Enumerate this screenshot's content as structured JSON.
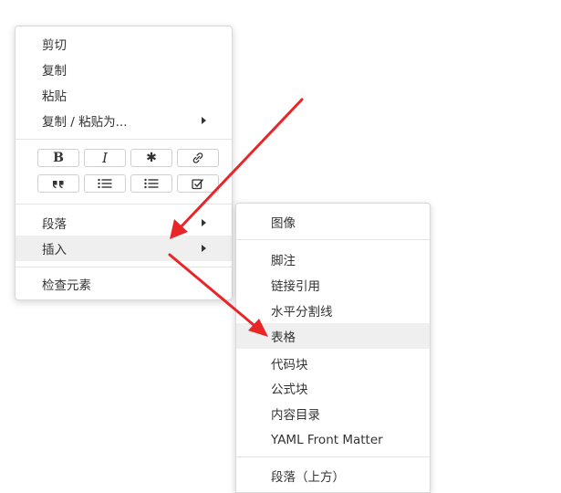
{
  "context_menu": {
    "items": [
      {
        "label": "剪切"
      },
      {
        "label": "复制"
      },
      {
        "label": "粘贴"
      },
      {
        "label": "复制 / 粘贴为..."
      }
    ],
    "format_toolbar": {
      "row1": [
        {
          "icon": "bold-icon",
          "glyph": "B"
        },
        {
          "icon": "italic-icon",
          "glyph": "I"
        },
        {
          "icon": "asterisk-icon",
          "glyph": "✱"
        },
        {
          "icon": "link-icon",
          "glyph": ""
        }
      ],
      "row2": [
        {
          "icon": "quote-icon",
          "glyph": ""
        },
        {
          "icon": "ordered-list-icon",
          "glyph": ""
        },
        {
          "icon": "unordered-list-icon",
          "glyph": ""
        },
        {
          "icon": "task-list-icon",
          "glyph": ""
        }
      ]
    },
    "paragraph_label": "段落",
    "insert_label": "插入",
    "inspect_label": "检查元素"
  },
  "insert_submenu": {
    "items": [
      {
        "label": "图像"
      },
      {
        "label": "脚注"
      },
      {
        "label": "链接引用"
      },
      {
        "label": "水平分割线"
      },
      {
        "label": "表格"
      },
      {
        "label": "代码块"
      },
      {
        "label": "公式块"
      },
      {
        "label": "内容目录"
      },
      {
        "label": "YAML Front Matter"
      },
      {
        "label": "段落（上方）"
      }
    ],
    "highlighted": "表格"
  },
  "colors": {
    "annotation_arrow": "#e8262a",
    "hover_background": "#efefef",
    "menu_border": "#d9d9d9"
  }
}
